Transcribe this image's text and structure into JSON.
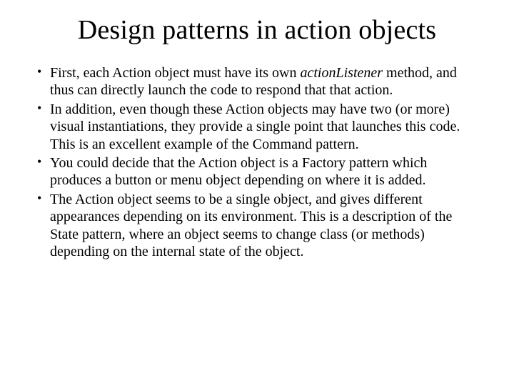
{
  "title": "Design patterns in action objects",
  "bullets": [
    {
      "pre": "First, each Action object must have its own ",
      "em": "actionListener",
      "post": " method, and thus can directly launch the code to respond that that action."
    },
    {
      "pre": "In addition, even though these Action objects may have two (or more) visual instantiations, they provide a single point that launches this code. This is an excellent example of the Command pattern.",
      "em": "",
      "post": ""
    },
    {
      "pre": "You could decide that the Action object is a Factory pattern which produces a button or menu object depending on where it is added.",
      "em": "",
      "post": ""
    },
    {
      "pre": "The Action object seems to be a single object, and gives different appearances depending on its environment. This is a description of the State pattern, where an object seems to change class (or methods) depending on the internal state of the object.",
      "em": "",
      "post": ""
    }
  ]
}
